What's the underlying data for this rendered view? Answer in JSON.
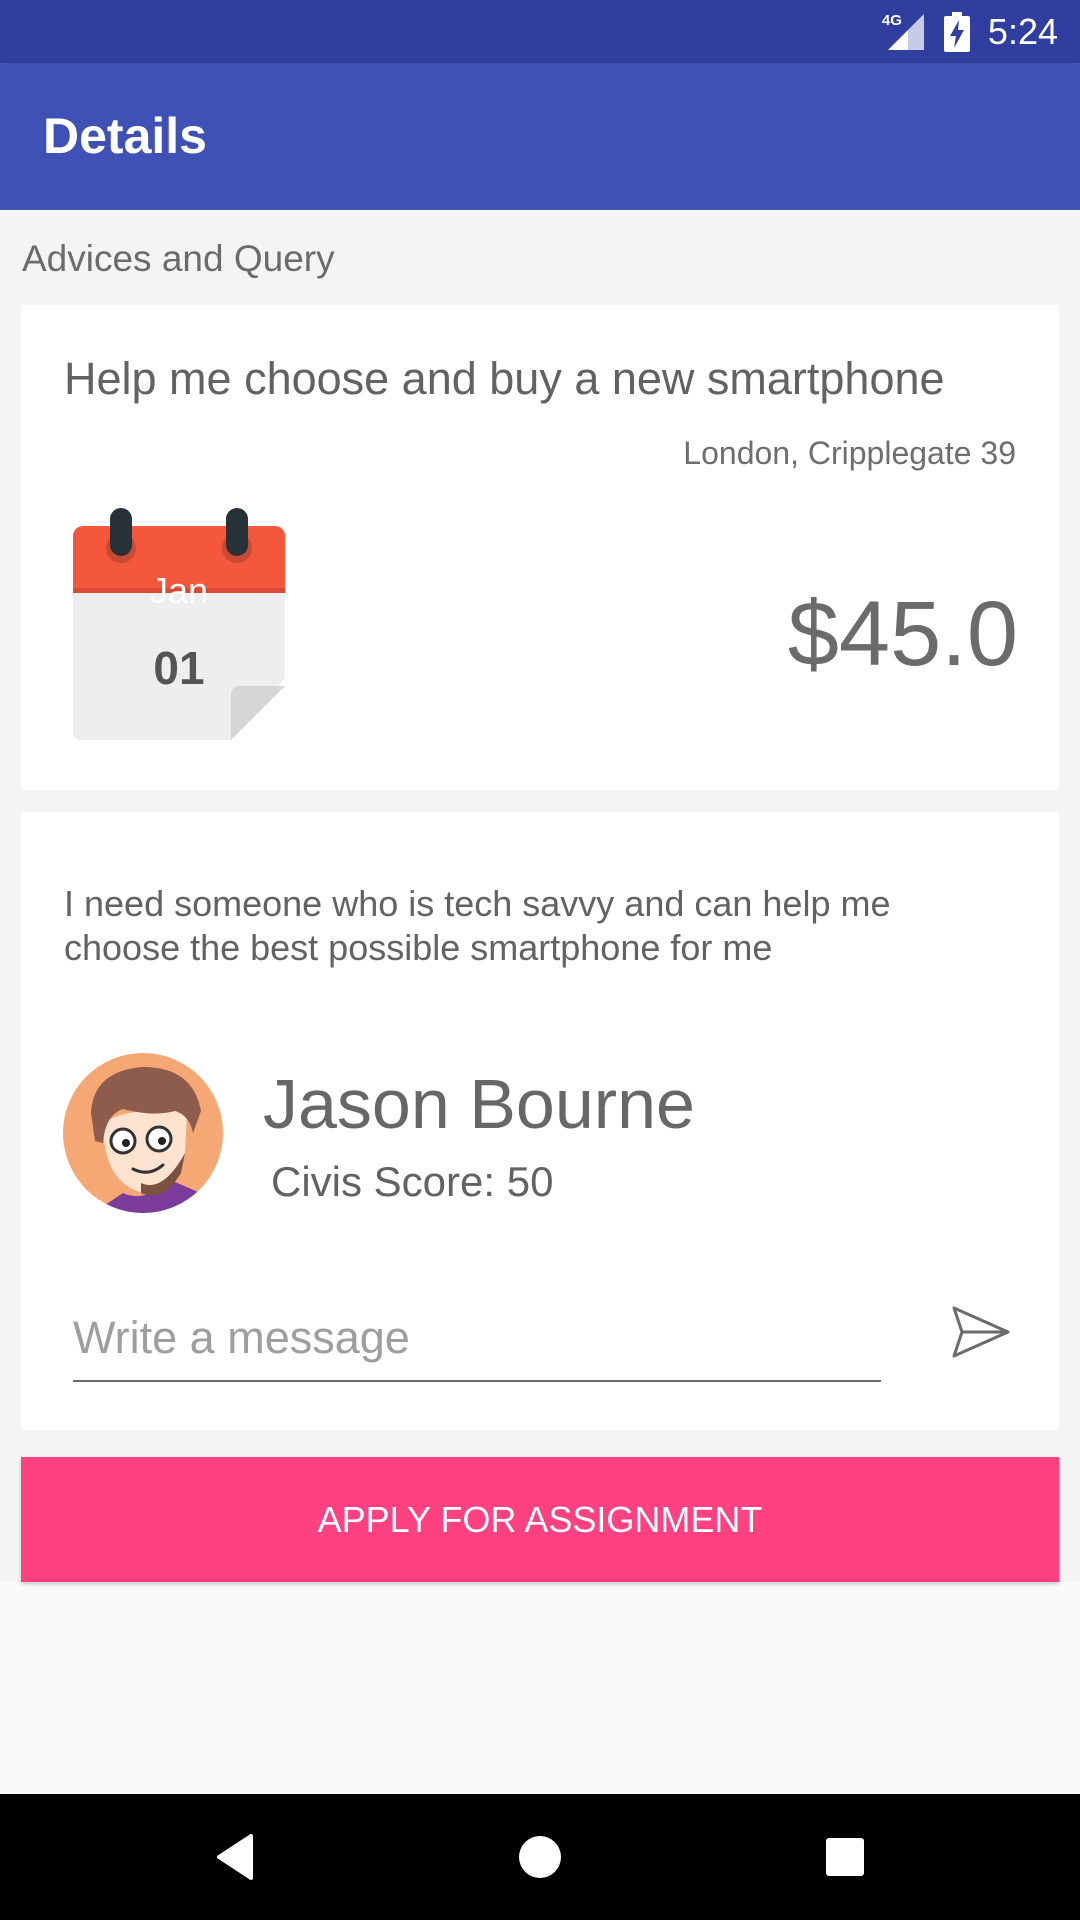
{
  "status_bar": {
    "network": "4G",
    "time": "5:24",
    "icons": [
      "signal-icon",
      "battery-charging-icon"
    ]
  },
  "app_bar": {
    "title": "Details"
  },
  "section": {
    "label": "Advices and Query"
  },
  "task": {
    "title": "Help me choose and buy a new smartphone",
    "location": "London, Cripplegate 39",
    "date": {
      "month": "Jan",
      "day": "01"
    },
    "price": "$45.0",
    "description": "I need someone who is tech savvy and can help me choose the best possible smartphone for me"
  },
  "user": {
    "name": "Jason Bourne",
    "score": "Civis Score: 50"
  },
  "message": {
    "placeholder": "Write a message",
    "value": ""
  },
  "apply": {
    "label": "APPLY FOR ASSIGNMENT"
  },
  "nav": {
    "icons": [
      "back-icon",
      "home-icon",
      "recents-icon"
    ]
  },
  "colors": {
    "status_bar": "#303f9f",
    "primary": "#3f51b5",
    "accent": "#ff4081",
    "calendar_header": "#f4573b"
  }
}
